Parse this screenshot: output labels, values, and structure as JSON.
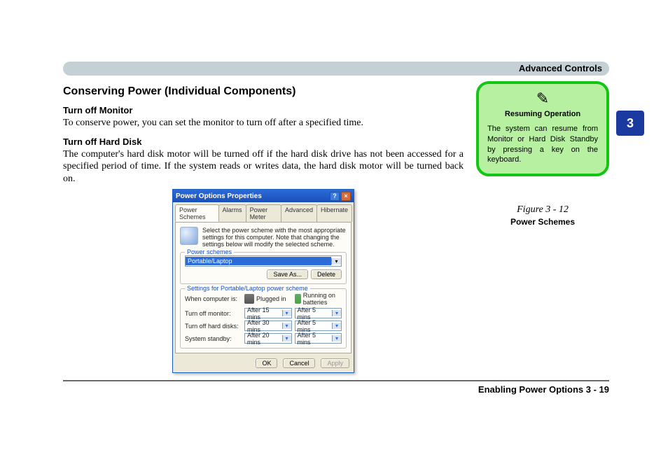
{
  "header": {
    "section_title": "Advanced Controls"
  },
  "thumb_tab": "3",
  "main": {
    "heading": "Conserving Power (Individual Components)",
    "sections": [
      {
        "title": "Turn off Monitor",
        "body": "To conserve power, you can set the monitor to turn off after a specified time."
      },
      {
        "title": "Turn off Hard Disk",
        "body": "The computer's hard disk motor will be turned off if the hard disk drive has not been accessed for a specified period of time. If the system reads or writes data, the hard disk motor will be turned back on."
      }
    ]
  },
  "callout": {
    "icon": "✎",
    "title": "Resuming Operation",
    "body": "The system can resume from Monitor or Hard Disk Standby by pressing a key on the keyboard."
  },
  "figure": {
    "line": "Figure 3 - 12",
    "title": "Power Schemes"
  },
  "dialog": {
    "title": "Power Options Properties",
    "help_glyph": "?",
    "close_glyph": "×",
    "tabs": [
      "Power Schemes",
      "Alarms",
      "Power Meter",
      "Advanced",
      "Hibernate"
    ],
    "active_tab_index": 0,
    "info_text": "Select the power scheme with the most appropriate settings for this computer. Note that changing the settings below will modify the selected scheme.",
    "schemes_legend": "Power schemes",
    "schemes_selected": "Portable/Laptop",
    "save_as_btn": "Save As...",
    "delete_btn": "Delete",
    "settings_legend": "Settings for Portable/Laptop power scheme",
    "col_label": "When computer is:",
    "col_plugged": "Plugged in",
    "col_battery": "Running on batteries",
    "rows": [
      {
        "label": "Turn off monitor:",
        "plugged": "After 15 mins",
        "battery": "After 5 mins"
      },
      {
        "label": "Turn off hard disks:",
        "plugged": "After 30 mins",
        "battery": "After 5 mins"
      },
      {
        "label": "System standby:",
        "plugged": "After 20 mins",
        "battery": "After 5 mins"
      }
    ],
    "ok_btn": "OK",
    "cancel_btn": "Cancel",
    "apply_btn": "Apply"
  },
  "footer": {
    "text": "Enabling Power Options  3  -  19"
  }
}
